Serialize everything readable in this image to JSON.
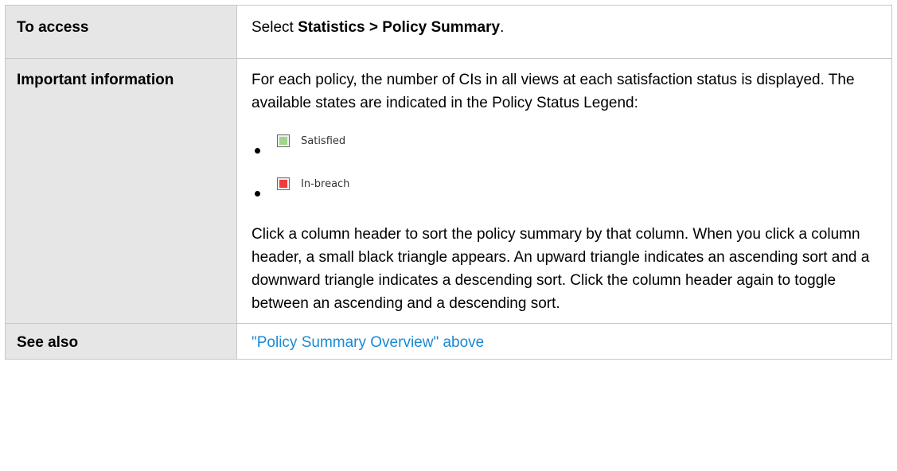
{
  "rows": {
    "access": {
      "label": "To access",
      "prefix": "Select ",
      "path": "Statistics > Policy Summary",
      "suffix": "."
    },
    "important": {
      "label": "Important information",
      "intro": "For each policy, the number of CIs in all views at each satisfaction status is displayed. The available states are indicated in the Policy Status Legend:",
      "legend": [
        {
          "label": "Satisfied",
          "color": "#9fd68a",
          "icon": "satisfied-swatch-icon"
        },
        {
          "label": "In-breach",
          "color": "#ef3b3b",
          "icon": "in-breach-swatch-icon"
        }
      ],
      "sorting": "Click a column header to sort the policy summary by that column. When you click a column header, a small black triangle appears. An upward triangle indicates an ascending sort and a downward triangle indicates a descending sort. Click the column header again to toggle between an ascending and a descending sort."
    },
    "see_also": {
      "label": "See also",
      "link": "\"Policy Summary Overview\" above"
    }
  },
  "colors": {
    "label_bg": "#e6e6e6",
    "border": "#c8c8c8",
    "link": "#1a8ad4"
  }
}
